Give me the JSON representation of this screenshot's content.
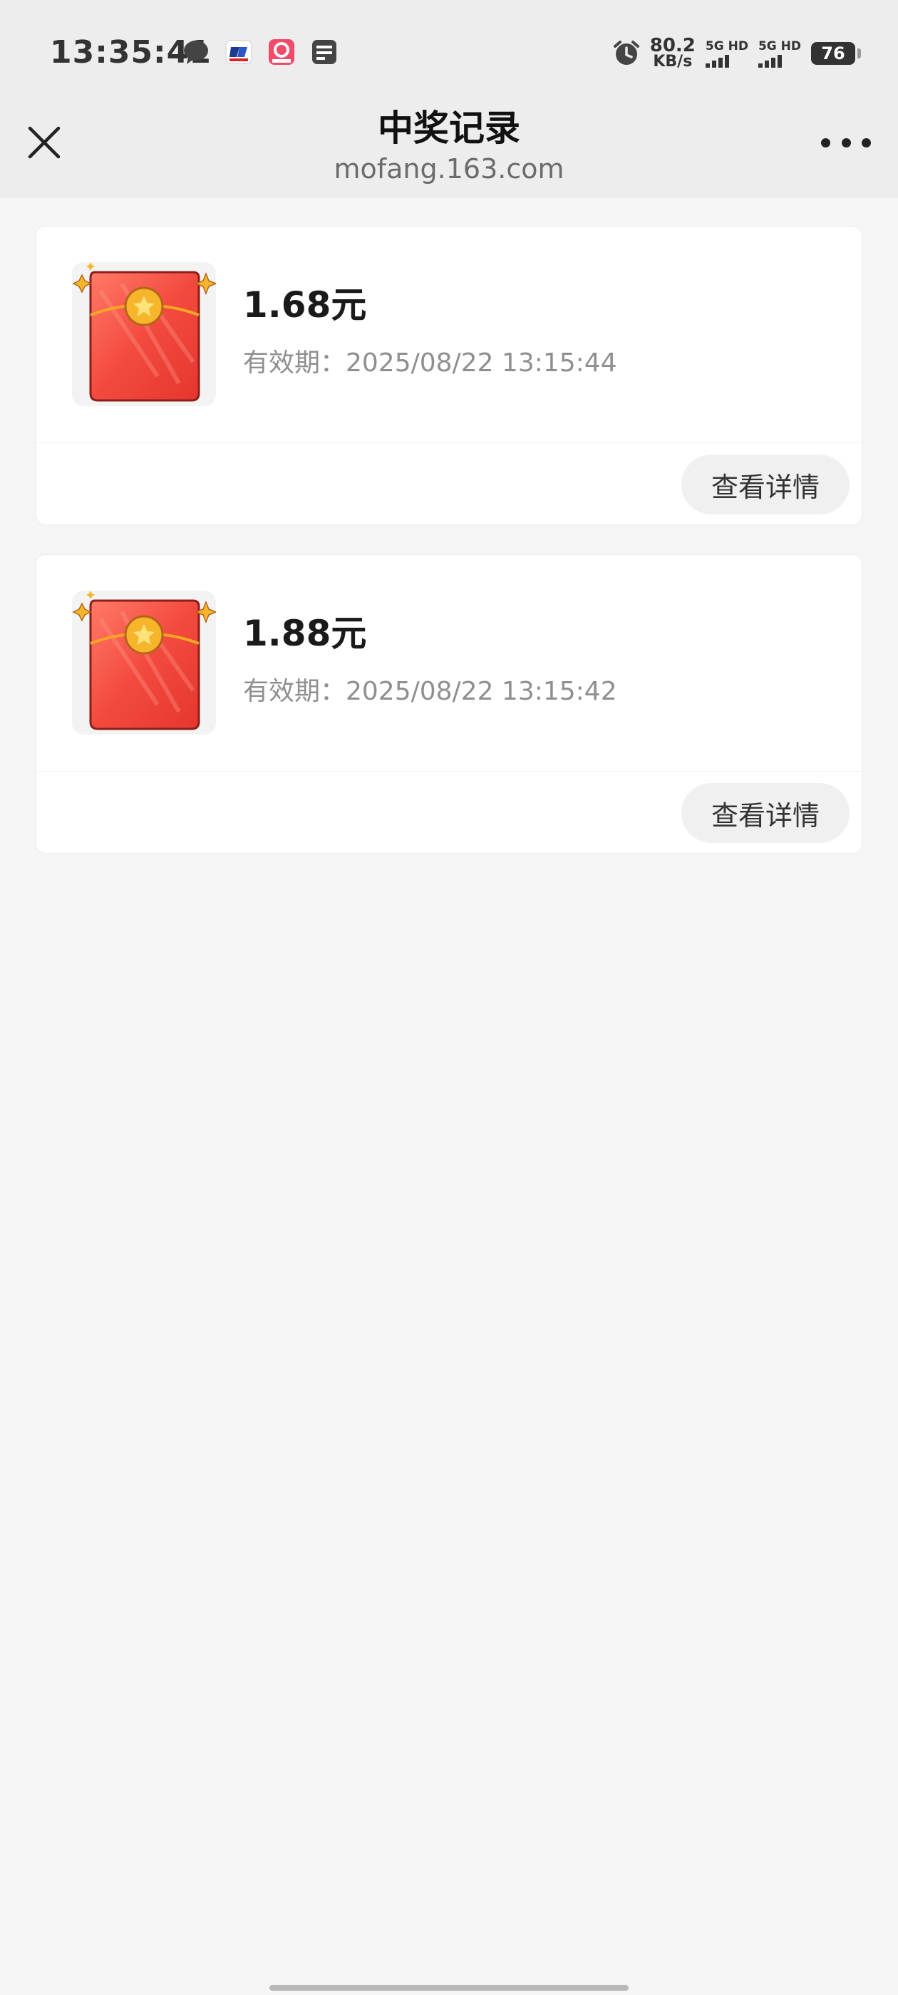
{
  "status_bar": {
    "time": "13:35:41",
    "net_speed_value": "80.2",
    "net_speed_unit": "KB/s",
    "sim1_label": "5G HD",
    "sim2_label": "5G HD",
    "battery": "76",
    "left_icons": [
      "chat-bubble-icon",
      "app-logo-icon",
      "shopping-app-icon",
      "wallet-card-icon"
    ],
    "right_icons": [
      "alarm-icon"
    ]
  },
  "nav": {
    "title": "中奖记录",
    "subtitle": "mofang.163.com",
    "close_icon": "close-icon",
    "more_icon": "more-dots-icon"
  },
  "records": [
    {
      "amount": "1.68元",
      "expiry": "有效期：2025/08/22 13:15:44",
      "detail_label": "查看详情",
      "icon": "red-envelope-icon"
    },
    {
      "amount": "1.88元",
      "expiry": "有效期：2025/08/22 13:15:42",
      "detail_label": "查看详情",
      "icon": "red-envelope-icon"
    }
  ],
  "colors": {
    "header_bg": "#ededed",
    "page_bg": "#f5f5f5",
    "envelope_red": "#f0433a",
    "coin_gold": "#f7b52c"
  }
}
